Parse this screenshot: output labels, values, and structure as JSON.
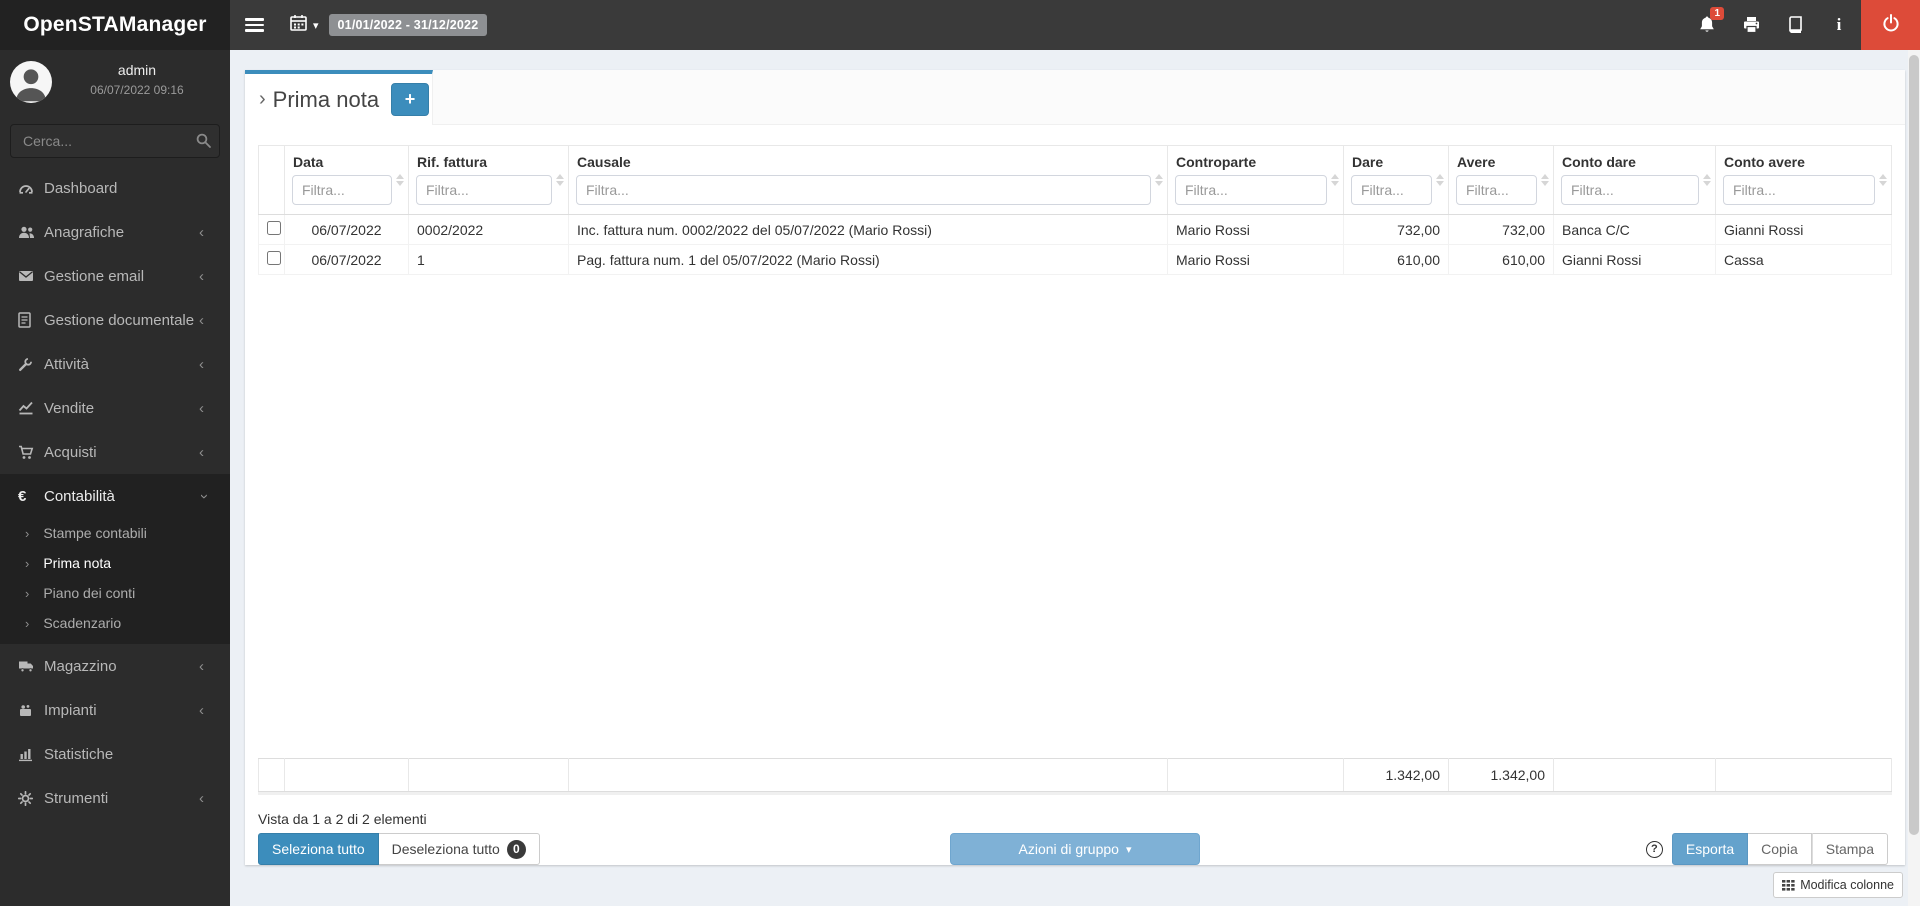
{
  "colors": {
    "accent": "#3c8dbc",
    "danger": "#dd4b39",
    "export_blue": "#64a2cc",
    "group_actions_blue": "#7fb1d6"
  },
  "navbar": {
    "brand": "OpenSTAManager",
    "date_range": "01/01/2022 - 31/12/2022",
    "notification_count": "1"
  },
  "sidebar": {
    "user": {
      "name": "admin",
      "datetime": "06/07/2022 09:16"
    },
    "search_placeholder": "Cerca...",
    "items": [
      {
        "label": "Dashboard",
        "icon": "dashboard-icon"
      },
      {
        "label": "Anagrafiche",
        "icon": "users-icon",
        "chevron": "‹"
      },
      {
        "label": "Gestione email",
        "icon": "envelope-icon",
        "chevron": "‹"
      },
      {
        "label": "Gestione documentale",
        "icon": "document-icon",
        "chevron": "‹"
      },
      {
        "label": "Attività",
        "icon": "wrench-icon",
        "chevron": "‹"
      },
      {
        "label": "Vendite",
        "icon": "chart-line-icon",
        "chevron": "‹"
      },
      {
        "label": "Acquisti",
        "icon": "cart-icon",
        "chevron": "‹"
      },
      {
        "label": "Contabilità",
        "icon": "euro-icon",
        "chevron": "down",
        "open": true,
        "children": [
          "Stampe contabili",
          "Prima nota",
          "Piano dei conti",
          "Scadenzario"
        ],
        "active_child": "Prima nota"
      },
      {
        "label": "Magazzino",
        "icon": "truck-icon",
        "chevron": "‹"
      },
      {
        "label": "Impianti",
        "icon": "impianti-icon",
        "chevron": "‹"
      },
      {
        "label": "Statistiche",
        "icon": "bar-chart-icon"
      },
      {
        "label": "Strumenti",
        "icon": "gear-icon",
        "chevron": "‹"
      }
    ]
  },
  "page": {
    "title": "Prima nota",
    "add_button_label": "+"
  },
  "table": {
    "filter_placeholder": "Filtra...",
    "columns": [
      "Data",
      "Rif. fattura",
      "Causale",
      "Controparte",
      "Dare",
      "Avere",
      "Conto dare",
      "Conto avere"
    ],
    "rows": [
      {
        "data": "06/07/2022",
        "rif_fattura": "0002/2022",
        "causale": "Inc. fattura num. 0002/2022 del 05/07/2022 (Mario Rossi)",
        "controparte": "Mario Rossi",
        "dare": "732,00",
        "avere": "732,00",
        "conto_dare": "Banca C/C",
        "conto_avere": "Gianni Rossi"
      },
      {
        "data": "06/07/2022",
        "rif_fattura": "1",
        "causale": "Pag. fattura num. 1 del 05/07/2022 (Mario Rossi)",
        "controparte": "Mario Rossi",
        "dare": "610,00",
        "avere": "610,00",
        "conto_dare": "Gianni Rossi",
        "conto_avere": "Cassa"
      }
    ],
    "totals": {
      "dare": "1.342,00",
      "avere": "1.342,00"
    }
  },
  "footer": {
    "results_info": "Vista da 1 a 2 di 2 elementi",
    "select_all_label": "Seleziona tutto",
    "deselect_all_label": "Deseleziona tutto",
    "deselect_count": "0",
    "group_actions_label": "Azioni di gruppo",
    "export_label": "Esporta",
    "copy_label": "Copia",
    "print_label": "Stampa",
    "help_icon": "?",
    "edit_columns_label": "Modifica colonne"
  }
}
